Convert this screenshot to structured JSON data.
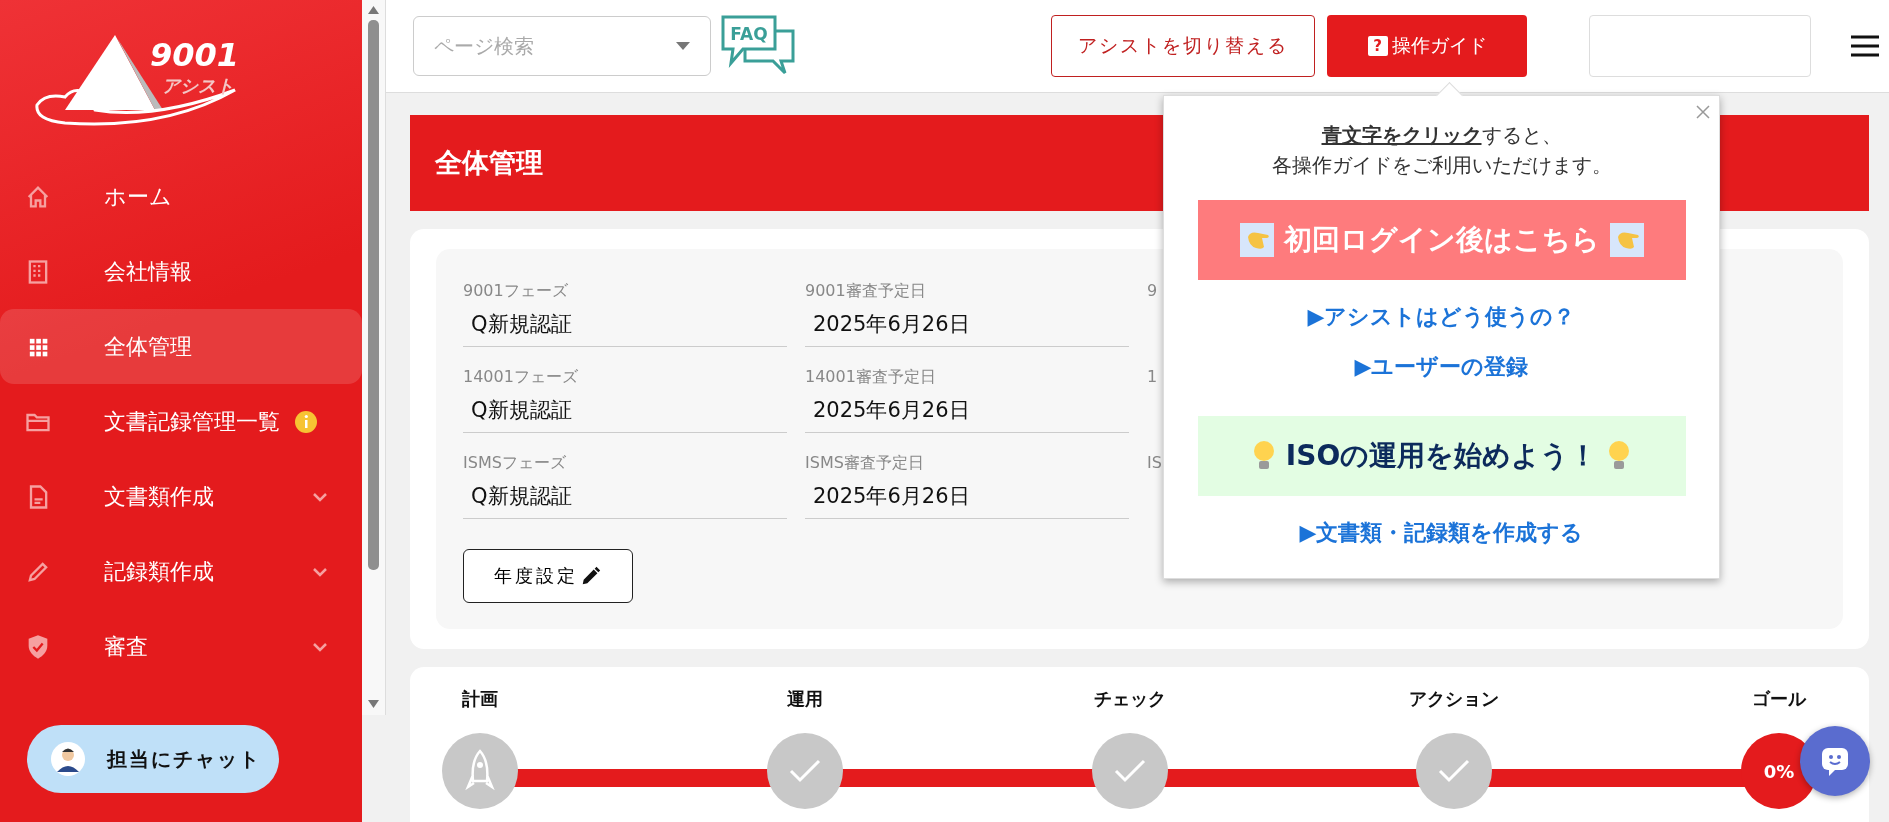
{
  "sidebar": {
    "logo": {
      "number": "9001",
      "name": "アシスト"
    },
    "items": [
      {
        "label": "ホーム",
        "selected": false
      },
      {
        "label": "会社情報",
        "selected": false
      },
      {
        "label": "全体管理",
        "selected": true
      },
      {
        "label": "文書記録管理一覧",
        "selected": false,
        "info_badge": true
      },
      {
        "label": "文書類作成",
        "selected": false,
        "expanded": false
      },
      {
        "label": "記録類作成",
        "selected": false,
        "expanded": false
      },
      {
        "label": "審査",
        "selected": false,
        "expanded": false
      }
    ],
    "chat_button": "担当にチャット"
  },
  "topbar": {
    "search": {
      "placeholder": "ページ検索"
    },
    "faq": "FAQ",
    "switch_button": "アシストを切り替える",
    "guide_button": {
      "mark": "?",
      "label": "操作ガイド"
    }
  },
  "page_title": "全体管理",
  "fields": [
    [
      {
        "label": "9001フェーズ",
        "value": "Q新規認証"
      },
      {
        "label": "9001審査予定日",
        "value": "2025年6月26日"
      },
      {
        "label": "9"
      }
    ],
    [
      {
        "label": "14001フェーズ",
        "value": "Q新規認証"
      },
      {
        "label": "14001審査予定日",
        "value": "2025年6月26日"
      },
      {
        "label": "1"
      }
    ],
    [
      {
        "label": "ISMSフェーズ",
        "value": "Q新規認証"
      },
      {
        "label": "ISMS審査予定日",
        "value": "2025年6月26日"
      },
      {
        "label": "IS"
      }
    ]
  ],
  "year_button": "年度設定",
  "progress": [
    {
      "label": "計画",
      "kind": "rocket"
    },
    {
      "label": "運用",
      "kind": "check"
    },
    {
      "label": "チェック",
      "kind": "check"
    },
    {
      "label": "アクション",
      "kind": "check"
    },
    {
      "label": "ゴール",
      "kind": "goal",
      "value": "0%"
    }
  ],
  "guide_popup": {
    "intro": [
      "**青文字をクリック**すると、",
      "各操作ガイドをご利用いただけます。"
    ],
    "entries": [
      {
        "kind": "pointer",
        "text": "初回ログイン後はこちら",
        "color": "#fe7b7d"
      },
      {
        "kind": "link",
        "text": "▶アシストはどう使うの？"
      },
      {
        "kind": "link",
        "text": "▶ユーザーの登録"
      },
      {
        "kind": "bulb",
        "text": "ISOの運用を始めよう！",
        "color": "#e3fde3"
      },
      {
        "kind": "link",
        "text": "▶文書類・記録類を作成する"
      }
    ]
  }
}
